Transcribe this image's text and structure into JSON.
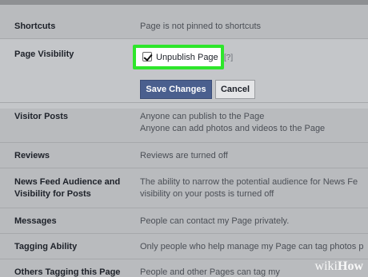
{
  "settings": {
    "shortcuts": {
      "label": "Shortcuts",
      "value": "Page is not pinned to shortcuts"
    },
    "page_visibility": {
      "label": "Page Visibility",
      "checkbox_label": "Unpublish Page",
      "checkbox_checked": true,
      "help": "[?]",
      "save_label": "Save Changes",
      "cancel_label": "Cancel"
    },
    "visitor_posts": {
      "label": "Visitor Posts",
      "value_line1": "Anyone can publish to the Page",
      "value_line2": "Anyone can add photos and videos to the Page"
    },
    "reviews": {
      "label": "Reviews",
      "value": "Reviews are turned off"
    },
    "news_feed": {
      "label_line1": "News Feed Audience and",
      "label_line2": "Visibility for Posts",
      "value_line1": "The ability to narrow the potential audience for News Fe",
      "value_line2": "visibility on your posts is turned off"
    },
    "messages": {
      "label": "Messages",
      "value": "People can contact my Page privately."
    },
    "tagging_ability": {
      "label": "Tagging Ability",
      "value": "Only people who help manage my Page can tag photos p"
    },
    "others_tagging": {
      "label": "Others Tagging this Page",
      "value": "People and other Pages can tag my"
    }
  },
  "watermark": {
    "wiki": "wiki",
    "how": "How"
  },
  "colors": {
    "highlight": "#2ee62b",
    "save_button": "#4a5f8e"
  }
}
